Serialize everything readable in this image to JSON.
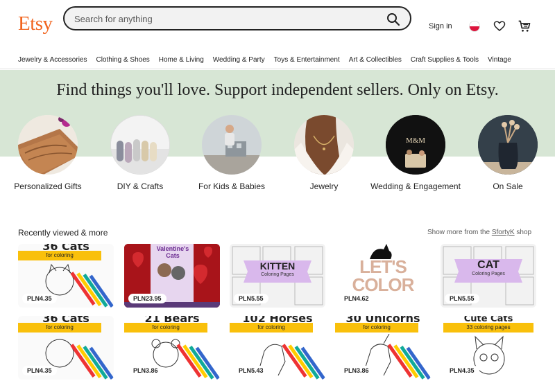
{
  "header": {
    "logo": "Etsy",
    "search_placeholder": "Search for anything",
    "signin": "Sign in"
  },
  "nav": [
    "Jewelry & Accessories",
    "Clothing & Shoes",
    "Home & Living",
    "Wedding & Party",
    "Toys & Entertainment",
    "Art & Collectibles",
    "Craft Supplies & Tools",
    "Vintage"
  ],
  "hero": {
    "tagline": "Find things you'll love. Support independent sellers. Only on Etsy."
  },
  "categories": [
    {
      "label": "Personalized Gifts"
    },
    {
      "label": "DIY & Crafts"
    },
    {
      "label": "For Kids & Babies"
    },
    {
      "label": "Jewelry"
    },
    {
      "label": "Wedding & Engagement"
    },
    {
      "label": "On Sale"
    }
  ],
  "recent": {
    "title": "Recently viewed & more",
    "more_prefix": "Show more from the",
    "shop_name": "SfortyK",
    "more_suffix": "shop",
    "items": [
      {
        "title": "36 Cats",
        "banner": "for coloring",
        "price": "PLN4.35"
      },
      {
        "title": "Valentine's Cats",
        "banner": "",
        "price": "PLN23.95"
      },
      {
        "title": "KITTEN",
        "banner": "Coloring Pages",
        "price": "PLN5.55"
      },
      {
        "title": "LET'S COLOR",
        "banner": "",
        "price": "PLN4.62"
      },
      {
        "title": "CAT",
        "banner": "Coloring Pages",
        "price": "PLN5.55"
      },
      {
        "title": "36 Cats",
        "banner": "for coloring",
        "price": "PLN4.35"
      },
      {
        "title": "21 Bears",
        "banner": "for coloring",
        "price": "PLN3.86"
      },
      {
        "title": "102 Horses",
        "banner": "for coloring",
        "price": "PLN5.43"
      },
      {
        "title": "30 Unicorns",
        "banner": "for coloring",
        "price": "PLN3.86"
      },
      {
        "title": "Cute Cats",
        "banner": "33 coloring pages",
        "price": "PLN4.35"
      }
    ]
  },
  "colors": {
    "brand": "#F1641E",
    "hero_bg": "#d7e6d5"
  }
}
